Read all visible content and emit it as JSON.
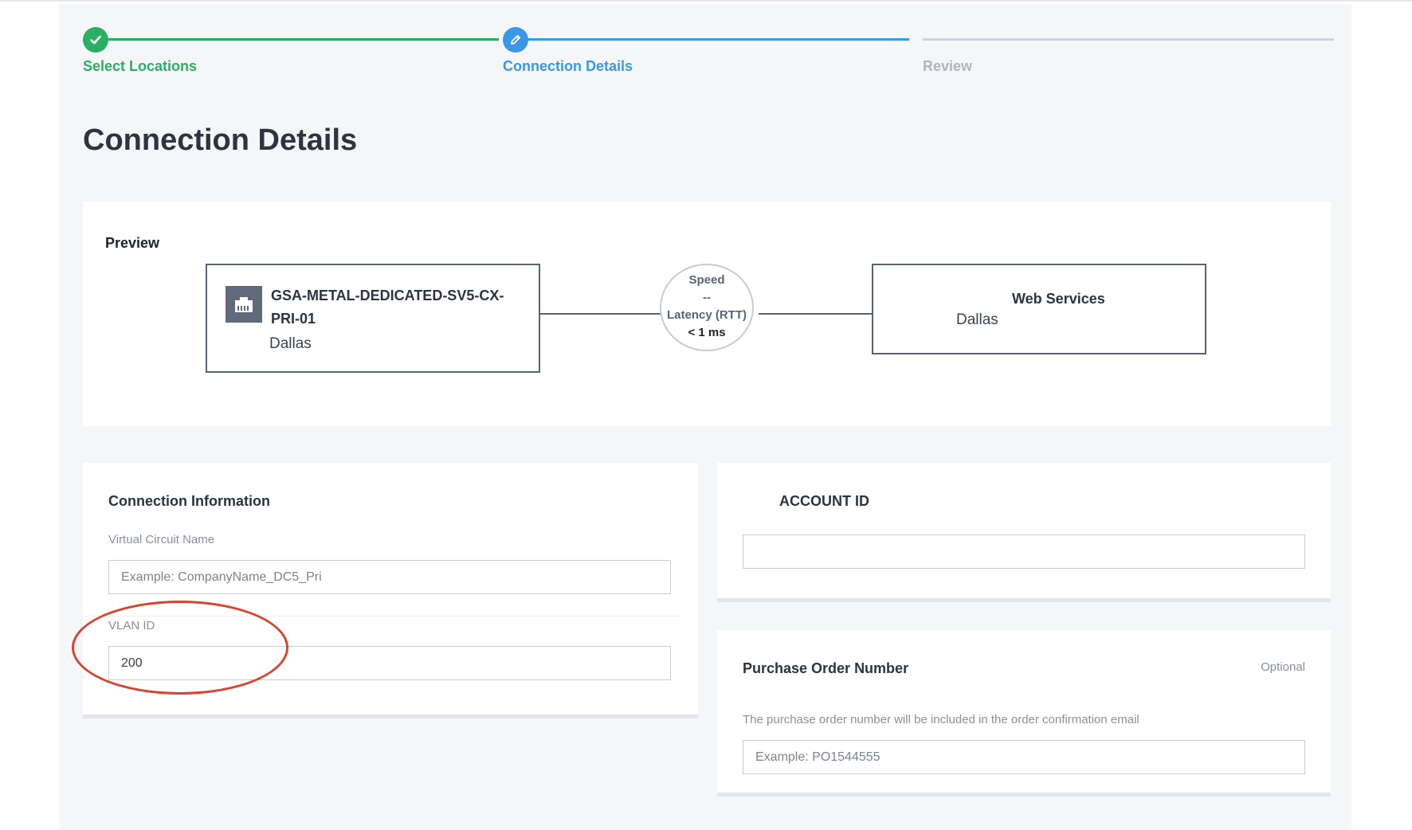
{
  "stepper": {
    "steps": [
      {
        "label": "Select Locations",
        "state": "complete",
        "icon": "check-icon"
      },
      {
        "label": "Connection Details",
        "state": "active",
        "icon": "pencil-icon"
      },
      {
        "label": "Review",
        "state": "pending"
      }
    ]
  },
  "page_title": "Connection Details",
  "preview": {
    "label": "Preview",
    "source": {
      "icon": "port-icon",
      "name": "GSA-METAL-DEDICATED-SV5-CX-PRI-01",
      "location": "Dallas"
    },
    "link": {
      "speed_label": "Speed",
      "speed_value": "--",
      "latency_label": "Latency (RTT)",
      "latency_value": "< 1 ms"
    },
    "destination": {
      "name": "Web Services",
      "location": "Dallas"
    }
  },
  "connection_info": {
    "title": "Connection Information",
    "vc_name": {
      "label": "Virtual Circuit Name",
      "value": "",
      "placeholder": "Example: CompanyName_DC5_Pri"
    },
    "vlan_id": {
      "label": "VLAN ID",
      "value": "200",
      "placeholder": ""
    }
  },
  "account": {
    "title": "ACCOUNT ID",
    "value": "",
    "placeholder": ""
  },
  "purchase_order": {
    "title": "Purchase Order Number",
    "optional_label": "Optional",
    "help": "The purchase order number will be included in the order confirmation email",
    "value": "",
    "placeholder": "Example: PO1544555"
  },
  "colors": {
    "complete": "#2aaf63",
    "active": "#3b97e8",
    "pending": "#cfd3d9",
    "annotation": "#d9432f"
  }
}
